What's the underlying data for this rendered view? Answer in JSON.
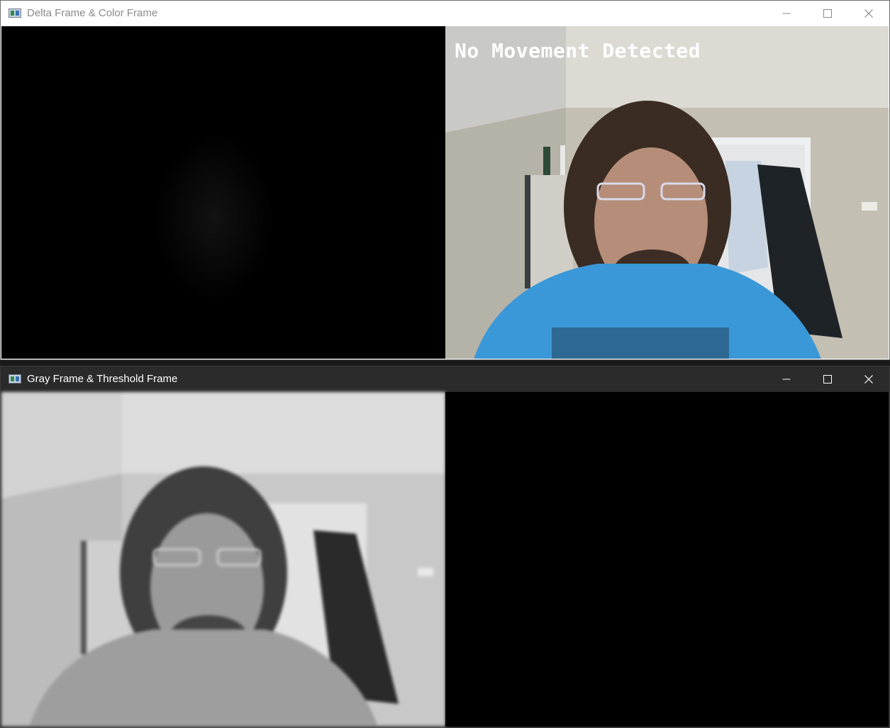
{
  "windows": [
    {
      "title": "Delta Frame & Color Frame",
      "controls": {
        "minimize": "minimize",
        "maximize": "maximize",
        "close": "close"
      }
    },
    {
      "title": "Gray Frame & Threshold Frame",
      "controls": {
        "minimize": "minimize",
        "maximize": "maximize",
        "close": "close"
      }
    }
  ],
  "overlay": {
    "status_text": "No Movement Detected"
  },
  "colors": {
    "overlay_text": "#ffffff",
    "title_active": "#ffffff",
    "title_inactive": "#8a8a8a",
    "shirt_blue": "#3a98d8"
  },
  "icons": [
    "app-window-icon",
    "minimize-icon",
    "maximize-icon",
    "close-icon"
  ]
}
